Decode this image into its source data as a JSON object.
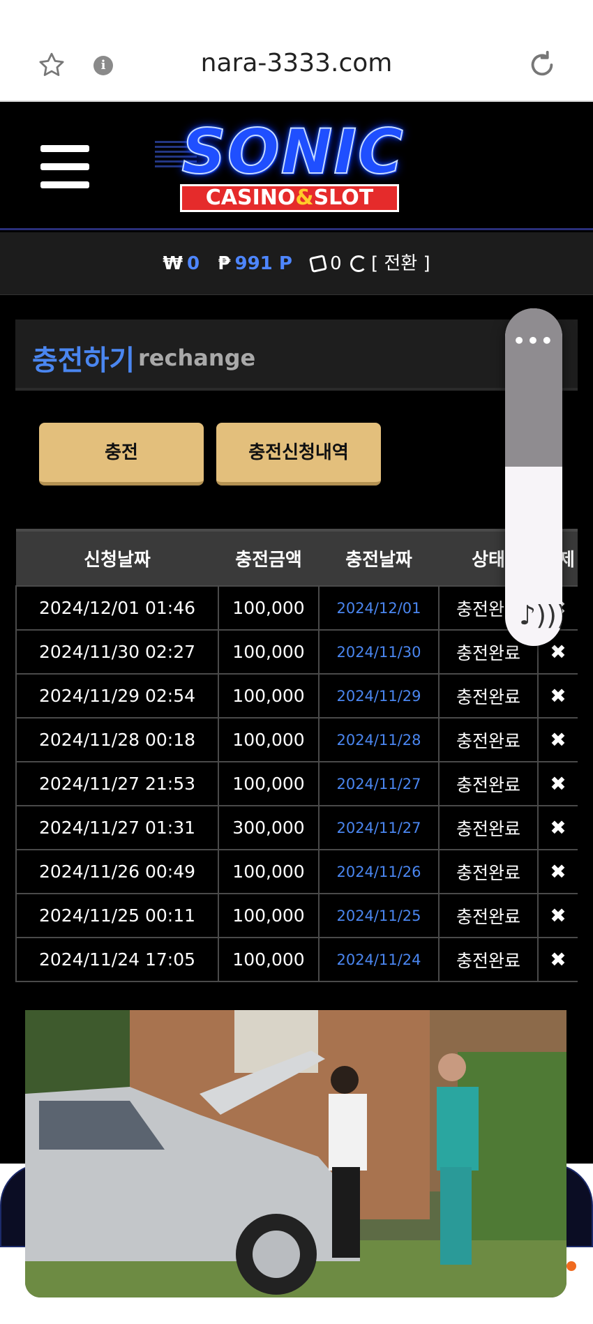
{
  "browser": {
    "url": "nara-3333.com",
    "icons": [
      "star-icon",
      "info-icon",
      "reload-icon"
    ]
  },
  "site": {
    "logo_main": "SONIC",
    "logo_sub_left": "CASINO",
    "logo_sub_amp": "&",
    "logo_sub_right": "SLOT"
  },
  "balance": {
    "won_symbol": "₩",
    "won_value": "0",
    "point_symbol": "₱",
    "point_value": "991 P",
    "dice_value": "0",
    "convert_label": "[ 전환 ]"
  },
  "panel": {
    "title_ko": "충전하기",
    "title_en": "rechange"
  },
  "buttons": {
    "charge": "충전",
    "history": "충전신청내역"
  },
  "table": {
    "headers": [
      "신청날짜",
      "충전금액",
      "충전날짜",
      "상태",
      "삭제"
    ],
    "rows": [
      {
        "request": "2024/12/01 01:46",
        "amount": "100,000",
        "date": "2024/12/01",
        "status": "충전완료",
        "del": "✖"
      },
      {
        "request": "2024/11/30 02:27",
        "amount": "100,000",
        "date": "2024/11/30",
        "status": "충전완료",
        "del": "✖"
      },
      {
        "request": "2024/11/29 02:54",
        "amount": "100,000",
        "date": "2024/11/29",
        "status": "충전완료",
        "del": "✖"
      },
      {
        "request": "2024/11/28 00:18",
        "amount": "100,000",
        "date": "2024/11/28",
        "status": "충전완료",
        "del": "✖"
      },
      {
        "request": "2024/11/27 21:53",
        "amount": "100,000",
        "date": "2024/11/27",
        "status": "충전완료",
        "del": "✖"
      },
      {
        "request": "2024/11/27 01:31",
        "amount": "300,000",
        "date": "2024/11/27",
        "status": "충전완료",
        "del": "✖"
      },
      {
        "request": "2024/11/26 00:49",
        "amount": "100,000",
        "date": "2024/11/26",
        "status": "충전완료",
        "del": "✖"
      },
      {
        "request": "2024/11/25 00:11",
        "amount": "100,000",
        "date": "2024/11/25",
        "status": "충전완료",
        "del": "✖"
      },
      {
        "request": "2024/11/24 17:05",
        "amount": "100,000",
        "date": "2024/11/24",
        "status": "충전완료",
        "del": "✖"
      }
    ]
  },
  "volume": {
    "menu": "•••",
    "level": 0.53
  },
  "colors": {
    "accent_blue": "#4a86f0",
    "button_gold": "#e3bf7c",
    "header_bg": "#3a3a3a"
  }
}
